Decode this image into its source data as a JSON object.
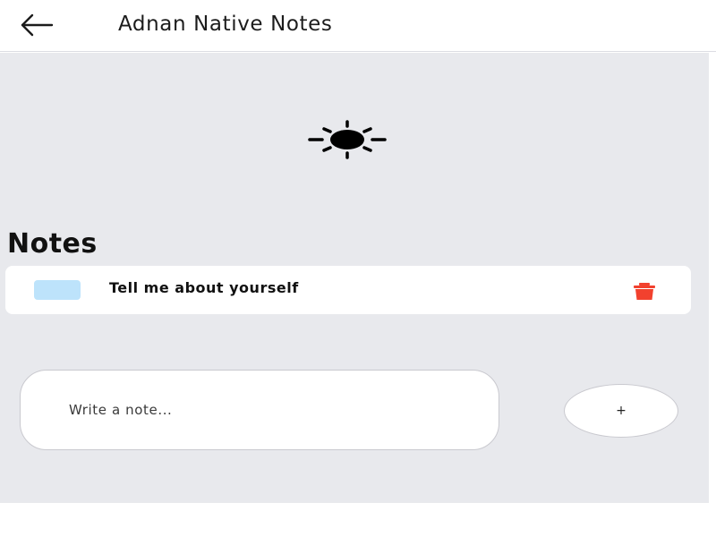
{
  "header": {
    "back_icon": "arrow-left-icon",
    "title": "Adnan Native Notes"
  },
  "theme": {
    "icon": "sun-icon"
  },
  "notes": {
    "heading": "Notes",
    "items": [
      {
        "text": "Tell me about yourself",
        "color": "#bde3fb",
        "delete_icon": "trash-icon",
        "delete_color": "#f2412e"
      }
    ]
  },
  "composer": {
    "placeholder": "Write a note...",
    "add_label": "+"
  },
  "colors": {
    "background": "#e8e9ed",
    "card": "#ffffff",
    "accent_delete": "#f2412e"
  }
}
